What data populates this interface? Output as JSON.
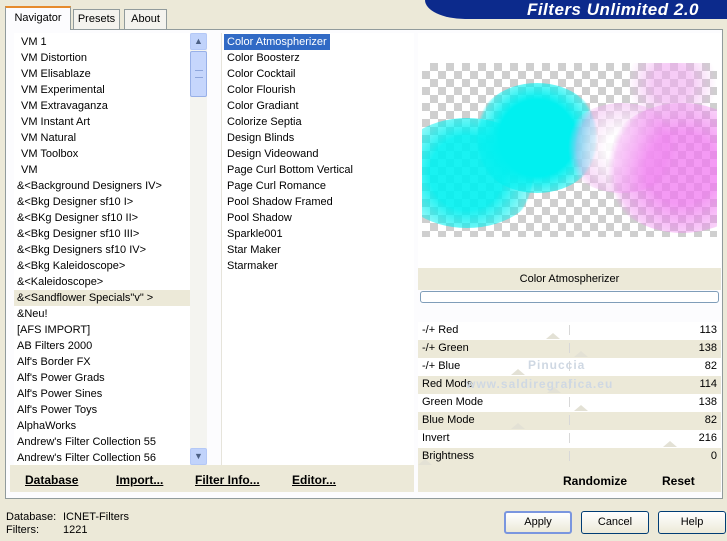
{
  "title": "Filters Unlimited 2.0",
  "tabs": [
    "Navigator",
    "Presets",
    "About"
  ],
  "categories": [
    "VM 1",
    "VM Distortion",
    "VM Elisablaze",
    "VM Experimental",
    "VM Extravaganza",
    "VM Instant Art",
    "VM Natural",
    "VM Toolbox",
    "VM",
    "&<Background Designers IV>",
    "&<Bkg Designer sf10 I>",
    "&<BKg Designer sf10 II>",
    "&<Bkg Designer sf10 III>",
    "&<Bkg Designers sf10 IV>",
    "&<Bkg Kaleidoscope>",
    "&<Kaleidoscope>",
    "&<Sandflower Specials\"v\" >",
    "&Neu!",
    "[AFS IMPORT]",
    "AB Filters 2000",
    "Alf's Border FX",
    "Alf's Power Grads",
    "Alf's Power Sines",
    "Alf's Power Toys",
    "AlphaWorks",
    "Andrew's Filter Collection 55",
    "Andrew's Filter Collection 56"
  ],
  "selected_category": "&<Sandflower Specials\"v\" >",
  "filters": [
    "Color Atmospherizer",
    "Color Boosterz",
    "Color Cocktail",
    "Color Flourish",
    "Color Gradiant",
    "Colorize Septia",
    "Design Blinds",
    "Design Videowand",
    "Page Curl Bottom Vertical",
    "Page Curl Romance",
    "Pool Shadow Framed",
    "Pool Shadow",
    "Sparkle001",
    "Star Maker",
    "Starmaker"
  ],
  "selected_filter": "Color Atmospherizer",
  "links": {
    "database": "Database",
    "import": "Import...",
    "filter_info": "Filter Info...",
    "editor": "Editor..."
  },
  "preview_filter_name": "Color Atmospherizer",
  "params": [
    {
      "label": "-/+ Red",
      "value": 113
    },
    {
      "label": "-/+ Green",
      "value": 138
    },
    {
      "label": "-/+ Blue",
      "value": 82
    },
    {
      "label": "Red Mode",
      "value": 114
    },
    {
      "label": "Green Mode",
      "value": 138
    },
    {
      "label": "Blue Mode",
      "value": 82
    },
    {
      "label": "Invert",
      "value": 216
    },
    {
      "label": "Brightness",
      "value": 0
    }
  ],
  "actions": {
    "randomize": "Randomize",
    "reset": "Reset"
  },
  "watermark": {
    "line1": "Pinuccia",
    "line2": "www.saldiregrafica.eu"
  },
  "footer": {
    "database_label": "Database:",
    "database_value": "ICNET-Filters",
    "filters_label": "Filters:",
    "filters_value": "1221",
    "apply": "Apply",
    "cancel": "Cancel",
    "help": "Help"
  },
  "colors": {
    "banner": "#0c2a8c",
    "selection": "#316ac5",
    "preview_cyan": "#00f0f0",
    "preview_pink": "#f08cf0"
  }
}
